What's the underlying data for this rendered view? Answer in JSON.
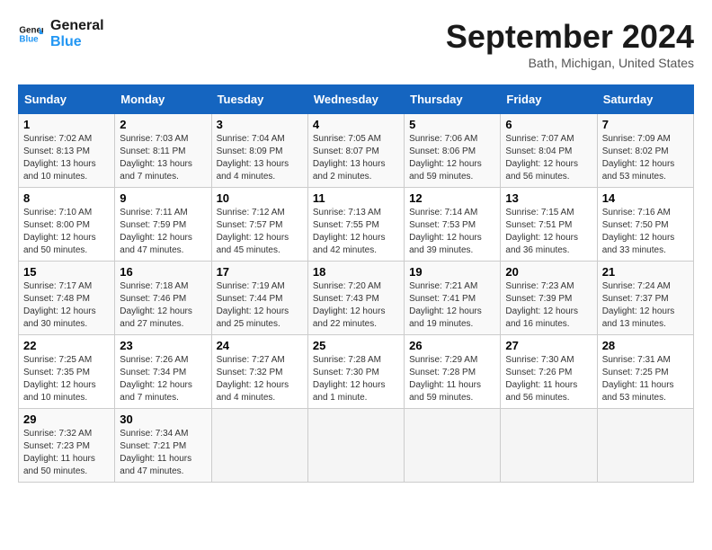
{
  "header": {
    "logo_line1": "General",
    "logo_line2": "Blue",
    "title": "September 2024",
    "subtitle": "Bath, Michigan, United States"
  },
  "columns": [
    "Sunday",
    "Monday",
    "Tuesday",
    "Wednesday",
    "Thursday",
    "Friday",
    "Saturday"
  ],
  "weeks": [
    [
      {
        "day": "1",
        "sunrise": "Sunrise: 7:02 AM",
        "sunset": "Sunset: 8:13 PM",
        "daylight": "Daylight: 13 hours and 10 minutes."
      },
      {
        "day": "2",
        "sunrise": "Sunrise: 7:03 AM",
        "sunset": "Sunset: 8:11 PM",
        "daylight": "Daylight: 13 hours and 7 minutes."
      },
      {
        "day": "3",
        "sunrise": "Sunrise: 7:04 AM",
        "sunset": "Sunset: 8:09 PM",
        "daylight": "Daylight: 13 hours and 4 minutes."
      },
      {
        "day": "4",
        "sunrise": "Sunrise: 7:05 AM",
        "sunset": "Sunset: 8:07 PM",
        "daylight": "Daylight: 13 hours and 2 minutes."
      },
      {
        "day": "5",
        "sunrise": "Sunrise: 7:06 AM",
        "sunset": "Sunset: 8:06 PM",
        "daylight": "Daylight: 12 hours and 59 minutes."
      },
      {
        "day": "6",
        "sunrise": "Sunrise: 7:07 AM",
        "sunset": "Sunset: 8:04 PM",
        "daylight": "Daylight: 12 hours and 56 minutes."
      },
      {
        "day": "7",
        "sunrise": "Sunrise: 7:09 AM",
        "sunset": "Sunset: 8:02 PM",
        "daylight": "Daylight: 12 hours and 53 minutes."
      }
    ],
    [
      {
        "day": "8",
        "sunrise": "Sunrise: 7:10 AM",
        "sunset": "Sunset: 8:00 PM",
        "daylight": "Daylight: 12 hours and 50 minutes."
      },
      {
        "day": "9",
        "sunrise": "Sunrise: 7:11 AM",
        "sunset": "Sunset: 7:59 PM",
        "daylight": "Daylight: 12 hours and 47 minutes."
      },
      {
        "day": "10",
        "sunrise": "Sunrise: 7:12 AM",
        "sunset": "Sunset: 7:57 PM",
        "daylight": "Daylight: 12 hours and 45 minutes."
      },
      {
        "day": "11",
        "sunrise": "Sunrise: 7:13 AM",
        "sunset": "Sunset: 7:55 PM",
        "daylight": "Daylight: 12 hours and 42 minutes."
      },
      {
        "day": "12",
        "sunrise": "Sunrise: 7:14 AM",
        "sunset": "Sunset: 7:53 PM",
        "daylight": "Daylight: 12 hours and 39 minutes."
      },
      {
        "day": "13",
        "sunrise": "Sunrise: 7:15 AM",
        "sunset": "Sunset: 7:51 PM",
        "daylight": "Daylight: 12 hours and 36 minutes."
      },
      {
        "day": "14",
        "sunrise": "Sunrise: 7:16 AM",
        "sunset": "Sunset: 7:50 PM",
        "daylight": "Daylight: 12 hours and 33 minutes."
      }
    ],
    [
      {
        "day": "15",
        "sunrise": "Sunrise: 7:17 AM",
        "sunset": "Sunset: 7:48 PM",
        "daylight": "Daylight: 12 hours and 30 minutes."
      },
      {
        "day": "16",
        "sunrise": "Sunrise: 7:18 AM",
        "sunset": "Sunset: 7:46 PM",
        "daylight": "Daylight: 12 hours and 27 minutes."
      },
      {
        "day": "17",
        "sunrise": "Sunrise: 7:19 AM",
        "sunset": "Sunset: 7:44 PM",
        "daylight": "Daylight: 12 hours and 25 minutes."
      },
      {
        "day": "18",
        "sunrise": "Sunrise: 7:20 AM",
        "sunset": "Sunset: 7:43 PM",
        "daylight": "Daylight: 12 hours and 22 minutes."
      },
      {
        "day": "19",
        "sunrise": "Sunrise: 7:21 AM",
        "sunset": "Sunset: 7:41 PM",
        "daylight": "Daylight: 12 hours and 19 minutes."
      },
      {
        "day": "20",
        "sunrise": "Sunrise: 7:23 AM",
        "sunset": "Sunset: 7:39 PM",
        "daylight": "Daylight: 12 hours and 16 minutes."
      },
      {
        "day": "21",
        "sunrise": "Sunrise: 7:24 AM",
        "sunset": "Sunset: 7:37 PM",
        "daylight": "Daylight: 12 hours and 13 minutes."
      }
    ],
    [
      {
        "day": "22",
        "sunrise": "Sunrise: 7:25 AM",
        "sunset": "Sunset: 7:35 PM",
        "daylight": "Daylight: 12 hours and 10 minutes."
      },
      {
        "day": "23",
        "sunrise": "Sunrise: 7:26 AM",
        "sunset": "Sunset: 7:34 PM",
        "daylight": "Daylight: 12 hours and 7 minutes."
      },
      {
        "day": "24",
        "sunrise": "Sunrise: 7:27 AM",
        "sunset": "Sunset: 7:32 PM",
        "daylight": "Daylight: 12 hours and 4 minutes."
      },
      {
        "day": "25",
        "sunrise": "Sunrise: 7:28 AM",
        "sunset": "Sunset: 7:30 PM",
        "daylight": "Daylight: 12 hours and 1 minute."
      },
      {
        "day": "26",
        "sunrise": "Sunrise: 7:29 AM",
        "sunset": "Sunset: 7:28 PM",
        "daylight": "Daylight: 11 hours and 59 minutes."
      },
      {
        "day": "27",
        "sunrise": "Sunrise: 7:30 AM",
        "sunset": "Sunset: 7:26 PM",
        "daylight": "Daylight: 11 hours and 56 minutes."
      },
      {
        "day": "28",
        "sunrise": "Sunrise: 7:31 AM",
        "sunset": "Sunset: 7:25 PM",
        "daylight": "Daylight: 11 hours and 53 minutes."
      }
    ],
    [
      {
        "day": "29",
        "sunrise": "Sunrise: 7:32 AM",
        "sunset": "Sunset: 7:23 PM",
        "daylight": "Daylight: 11 hours and 50 minutes."
      },
      {
        "day": "30",
        "sunrise": "Sunrise: 7:34 AM",
        "sunset": "Sunset: 7:21 PM",
        "daylight": "Daylight: 11 hours and 47 minutes."
      },
      null,
      null,
      null,
      null,
      null
    ]
  ]
}
